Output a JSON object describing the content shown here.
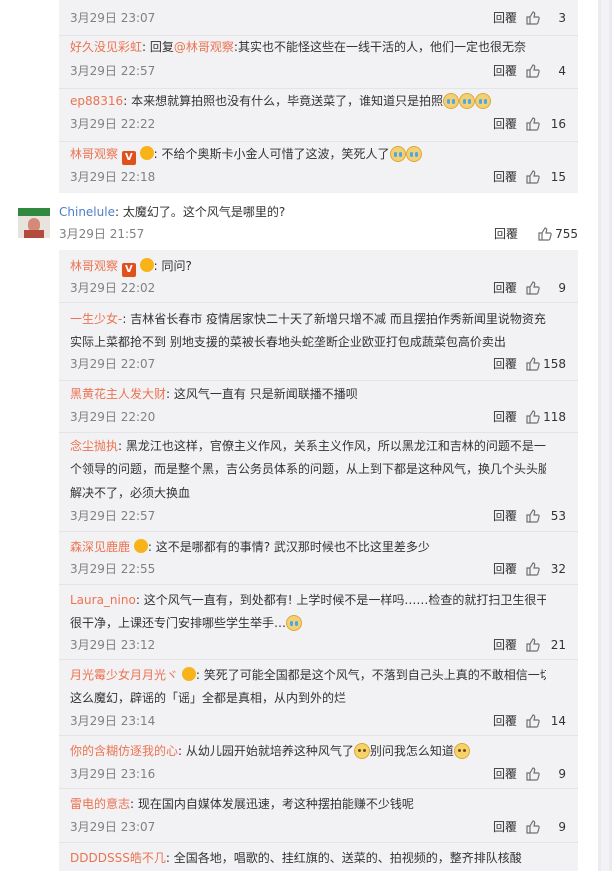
{
  "top_replies": [
    {
      "user": "",
      "text_prefix": "",
      "text_partial": "",
      "time": "3月29日 23:07",
      "reply_label": "回覆",
      "likes": "3"
    },
    {
      "user": "好久没见彩虹",
      "text_prefix": "回复",
      "mention": "@林哥观察",
      "text": ":其实也不能怪这些在一线干活的人，他们一定也很无奈",
      "time": "3月29日 22:57",
      "reply_label": "回覆",
      "likes": "4"
    },
    {
      "user": "ep88316",
      "text": "本来想就算拍照也没有什么，毕竟送菜了，谁知道只是拍照",
      "time": "3月29日 22:22",
      "reply_label": "回覆",
      "likes": "16"
    },
    {
      "user": "林哥观察",
      "badge_v": "V",
      "text": "不给个奥斯卡小金人可惜了这波，笑死人了",
      "time": "3月29日 22:18",
      "reply_label": "回覆",
      "likes": "15"
    }
  ],
  "main_comment": {
    "user": "Chinelule",
    "text": "太魔幻了。这个风气是哪里的?",
    "time": "3月29日 21:57",
    "reply_label": "回覆",
    "likes": "755"
  },
  "sub_replies": [
    {
      "user": "林哥观察",
      "badge_v": "V",
      "text": "同问?",
      "time": "3月29日 22:02",
      "reply_label": "回覆",
      "likes": "9"
    },
    {
      "user": "一生少女-",
      "text1": "吉林省长春市 疫情居家快二十天了新增只增不减 而且摆拍作秀新闻里说物资充足",
      "text2": "实际上菜都抢不到 别地支援的菜被长春地头蛇垄断企业欧亚打包成蔬菜包高价卖出",
      "time": "3月29日 22:07",
      "reply_label": "回覆",
      "likes": "158"
    },
    {
      "user": "黑黄花主人发大财",
      "text": "这风气一直有 只是新闻联播不播呗",
      "time": "3月29日 22:20",
      "reply_label": "回覆",
      "likes": "118"
    },
    {
      "user": "念尘抛执",
      "text1": "黑龙江也这样，官僚主义作风，关系主义作风，所以黑龙江和吉林的问题不是一两",
      "text2": "个领导的问题，而是整个黑，吉公务员体系的问题，从上到下都是这种风气，换几个头头脑脑",
      "text3": "解决不了，必须大换血",
      "time": "3月29日 22:57",
      "reply_label": "回覆",
      "likes": "53"
    },
    {
      "user": "森深见鹿鹿",
      "text": "这不是哪都有的事情? 武汉那时候也不比这里差多少",
      "time": "3月29日 22:55",
      "reply_label": "回覆",
      "likes": "32"
    },
    {
      "user": "Laura_nino",
      "text1": "这个风气一直有，到处都有! 上学时候不是一样吗……检查的就打扫卫生很干净",
      "text2": "很干净，上课还专门安排哪些学生举手…",
      "time": "3月29日 23:12",
      "reply_label": "回覆",
      "likes": "21"
    },
    {
      "user": "月光霉少女月月光ヾ",
      "text1": "笑死了可能全国都是这个风气，不落到自己头上真的不敢相信一切",
      "text2": "这么魔幻，辟谣的「谣」全都是真相，从内到外的烂",
      "time": "3月29日 23:14",
      "reply_label": "回覆",
      "likes": "14"
    },
    {
      "user": "你的含糊仿逐我的心",
      "text": "从幼儿园开始就培养这种风气了",
      "text_after": "别问我怎么知道",
      "time": "3月29日 23:16",
      "reply_label": "回覆",
      "likes": "9"
    },
    {
      "user": "雷电的意志",
      "text": "现在国内自媒体发展迅速，考这种摆拍能赚不少钱呢",
      "time": "3月29日 23:07",
      "reply_label": "回覆",
      "likes": "9"
    },
    {
      "user": "DDDDSSS皓不几",
      "text": "全国各地，唱歌的、挂红旗的、送菜的、拍视频的，整齐排队核酸"
    }
  ],
  "colors": {
    "username": "#eb7350",
    "username_blue": "#4d7fc8",
    "panel_bg": "#f2f2f5",
    "meta_gray": "#808080"
  }
}
